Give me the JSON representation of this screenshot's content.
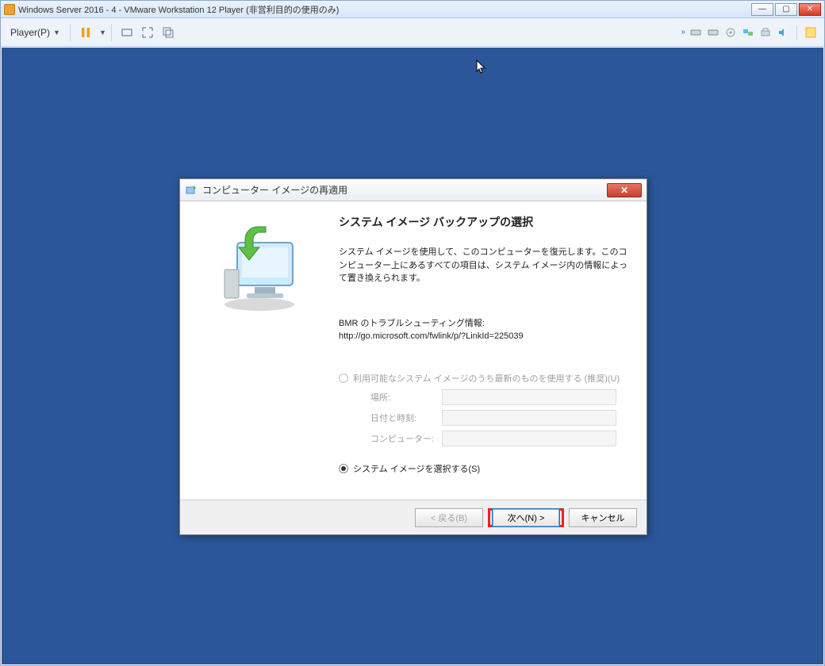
{
  "host": {
    "title": "Windows Server 2016 - 4 - VMware Workstation 12 Player (非営利目的の使用のみ)",
    "player_menu": "Player(P)"
  },
  "dialog": {
    "title": "コンピューター イメージの再適用",
    "heading": "システム イメージ バックアップの選択",
    "description": "システム イメージを使用して、このコンピューターを復元します。このコンピューター上にあるすべての項目は、システム イメージ内の情報によって置き換えられます。",
    "troubleshoot_label": "BMR のトラブルシューティング情報:",
    "troubleshoot_link": "http://go.microsoft.com/fwlink/p/?LinkId=225039",
    "radio_latest": "利用可能なシステム イメージのうち最新のものを使用する (推奨)(U)",
    "info": {
      "location_label": "場所:",
      "datetime_label": "日付と時刻:",
      "computer_label": "コンピューター:"
    },
    "radio_select": "システム イメージを選択する(S)",
    "buttons": {
      "back": "< 戻る(B)",
      "next": "次へ(N) >",
      "cancel": "キャンセル"
    }
  }
}
